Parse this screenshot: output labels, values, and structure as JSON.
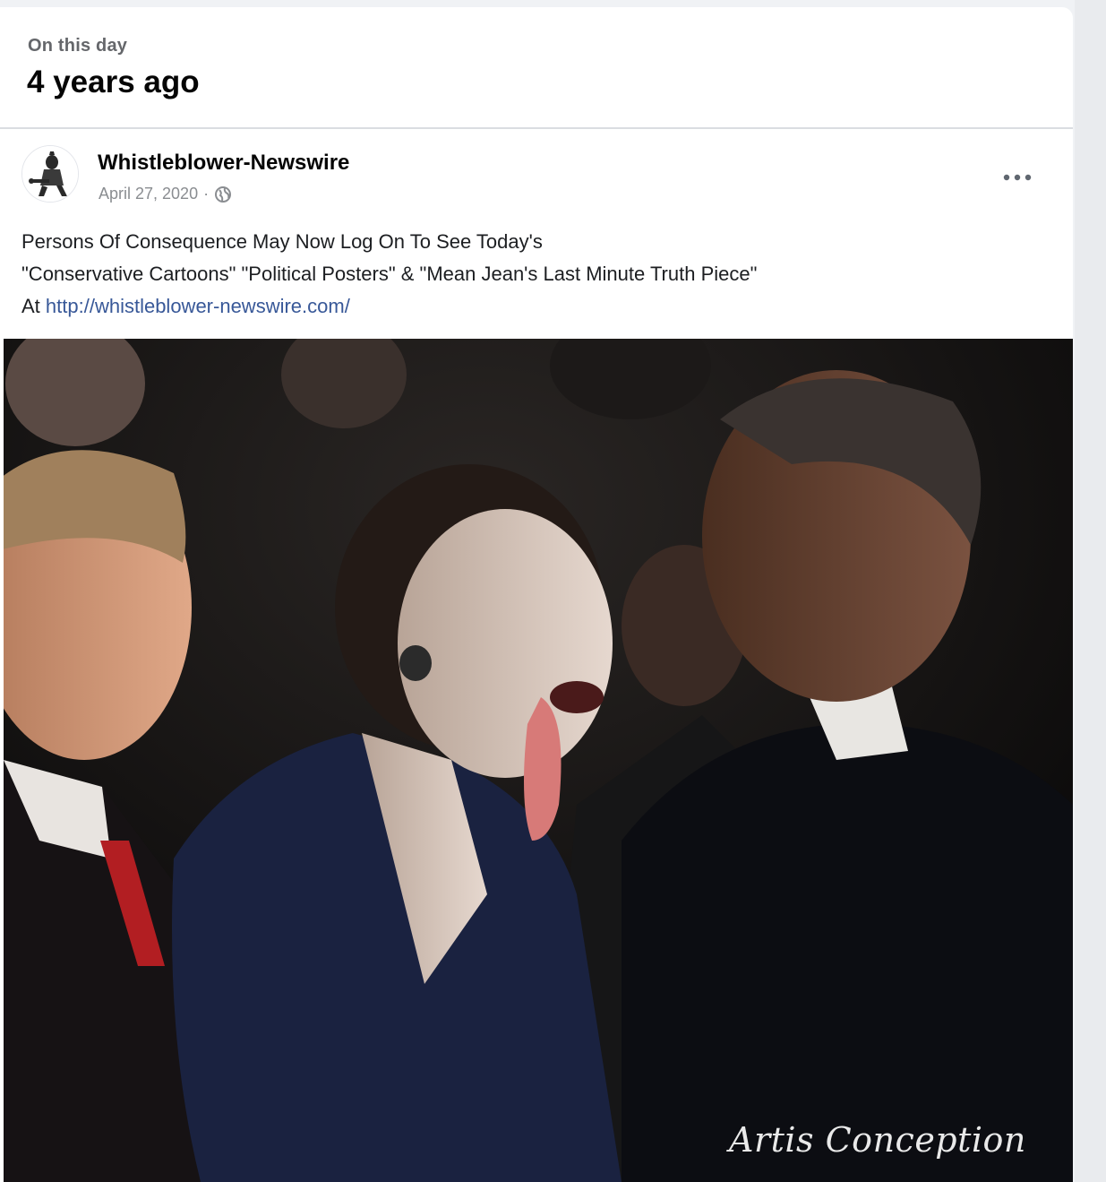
{
  "memory": {
    "kicker": "On this day",
    "title": "4 years ago"
  },
  "post": {
    "author": "Whistleblower-Newswire",
    "date": "April 27, 2020",
    "separator": "·",
    "privacy_icon": "globe-icon",
    "more_icon": "more-options-icon",
    "text_line1": "Persons Of Consequence May Now Log On To See Today's",
    "text_line2": "\"Conservative Cartoons\" \"Political Posters\" & \"Mean Jean's Last Minute Truth Piece\"",
    "text_line3_prefix": "At",
    "link": "http://whistleblower-newswire.com/",
    "image": {
      "watermark": "Artis Conception"
    }
  },
  "colors": {
    "background": "#f0f2f5",
    "card": "#ffffff",
    "secondary_text": "#65676b",
    "link": "#385898"
  }
}
